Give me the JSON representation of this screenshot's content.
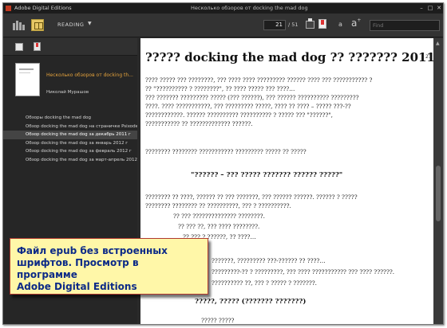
{
  "titlebar": {
    "app_name": "Adobe Digital Editions",
    "doc_title": "Несколько обзоров от docking the mad dog",
    "minimize": "–",
    "maximize": "□",
    "close": "✕"
  },
  "toolbar": {
    "reading_label": "READING",
    "page_current": "21",
    "page_total": "/ 51",
    "font_small": "a",
    "font_big": "a",
    "find_placeholder": "Find"
  },
  "sidebar": {
    "book_title": "Несколько обзоров от docking th...",
    "author": "Николай Мурашов",
    "toc": [
      "Обзоры docking the mad dog",
      "Обзор docking the mad dog на страничке Psixodeli",
      "Обзор docking the mad dog за декабрь 2011 г",
      "Обзор docking the mad dog за январь 2012 г",
      "Обзор docking the mad dog за февраль 2012 г",
      "Обзор docking the mad dog за март-апрель 2012 г"
    ],
    "active_index": 2
  },
  "content": {
    "heading": "????? docking the mad dog ?? ??????? 2011 ?",
    "page_number": "21",
    "lines": [
      "???? ????? ??? ????????, ??? ???? ???? ????????? ?????? ???? ??? ??????????? ?",
      "?? \"?????????? ? ????????\", ?? ???? ????? ??? ????…",
      "??? ??????? ????????? ????? (??? ??????), ??? ?????? ?????????? ?????????",
      "????. ???? ???????????, ??? ????????? ?????, ???? ?? ???? – ????? ???-??",
      "????????????. ?????? ?????????? ?????????? ? ????? ??? \"??????\",",
      "??????????? ?? ????????????? ??????.",
      "???????? ???????? ??????????? ????????? ????? ?? ?????",
      "\"?????? – ??? ????? ??????? ?????? ?????\"",
      "???????? ?? ????, ?????? ?? ??? ???????, ??? ?????? ??????. ?????? ? ?????",
      "???????? ???????? ?? ??????????, ??? ? ??????????.",
      "?? ??? ?????????????? ????????.",
      "?? ??? ??, ??? ???? ????????.",
      "?? ??? ? ??????, ?? ????…",
      "???????, ????????? ???-?????? ?? ????…",
      "?????????-?? ? ?????????, ??? ???? ??????????? ??? ???? ??????.",
      "?????????? ??, ??? ? ????? ? ???????.",
      "?????, ?????  (??????? ???????)",
      "?????  ?????"
    ]
  },
  "callout": {
    "line1": "Файл epub без встроенных",
    "line2": "шрифтов. Просмотр в программе",
    "line3": "Adobe Digital Editions"
  }
}
